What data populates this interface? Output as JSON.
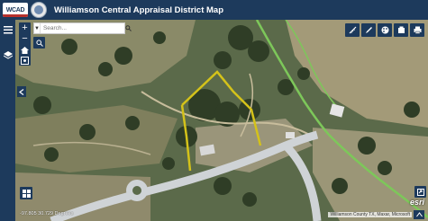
{
  "header": {
    "logo_text": "WCAD",
    "title": "Williamson Central Appraisal District Map"
  },
  "search": {
    "placeholder": "Search..."
  },
  "map": {
    "coordinates": "-97.805 30.729 Degrees",
    "attribution": "Williamson County TX, Maxar, Microsoft",
    "esri": "esri"
  },
  "icons": {
    "menu": "menu-icon",
    "layers": "layers-icon",
    "zoom_in": "plus-icon",
    "zoom_out": "minus-icon",
    "home": "home-icon",
    "locate": "locate-icon",
    "search": "search-icon",
    "basemap": "basemap-grid-icon"
  },
  "colors": {
    "header": "#1d3a5c",
    "parcel": "#d4c21a",
    "road": "#cfd3d6",
    "creek": "#7dc75a"
  }
}
